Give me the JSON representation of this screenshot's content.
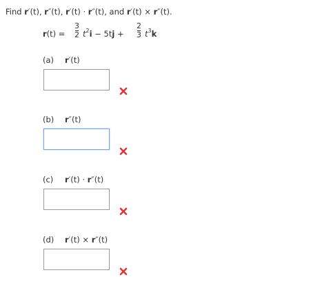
{
  "prompt": {
    "find": "Find ",
    "v1": "r",
    "v1_arg": "′(t), ",
    "v2": "r",
    "v2_arg": "″(t), ",
    "v3": "r",
    "v3_arg": "′(t) · ",
    "v4": "r",
    "v4_arg": "″(t), and ",
    "v5": "r",
    "v5_arg": "′(t) × ",
    "v6": "r",
    "v6_arg": "″(t)."
  },
  "equation": {
    "lhs_bold": "r",
    "lhs_rest": "(t) =",
    "frac1_num": "3",
    "frac1_den": "2",
    "term1": "t",
    "term1_exp": "2",
    "i": "i",
    "minus": " − 5t",
    "j": "j",
    "plus": " +",
    "frac2_num": "2",
    "frac2_den": "3",
    "term3": "t",
    "term3_exp": "3",
    "k": "k"
  },
  "parts": [
    {
      "letter": "(a)",
      "expr_bold1": "r",
      "expr_rest": "′(t)",
      "expr_bold2": "",
      "expr_tail": ""
    },
    {
      "letter": "(b)",
      "expr_bold1": "r",
      "expr_rest": "″(t)",
      "expr_bold2": "",
      "expr_tail": ""
    },
    {
      "letter": "(c)",
      "expr_bold1": "r",
      "expr_rest": "′(t) · ",
      "expr_bold2": "r",
      "expr_tail": "″(t)"
    },
    {
      "letter": "(d)",
      "expr_bold1": "r",
      "expr_rest": "′(t) × ",
      "expr_bold2": "r",
      "expr_tail": "″(t)"
    }
  ],
  "icons": {
    "incorrect": "x-mark-icon",
    "incorrect_color": "#d9383a"
  }
}
